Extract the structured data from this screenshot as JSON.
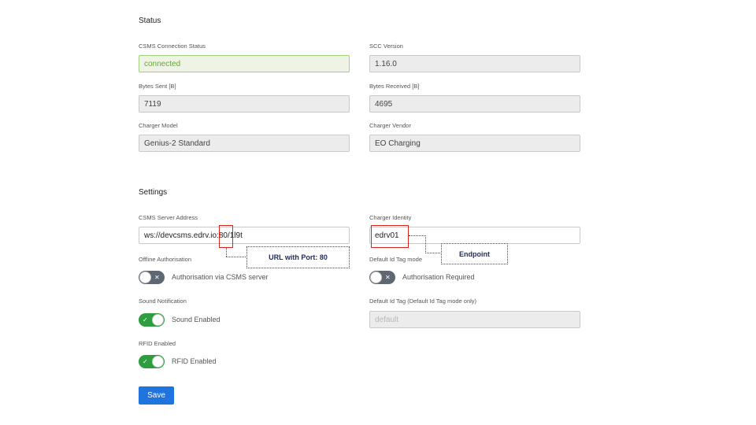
{
  "status": {
    "title": "Status",
    "csms_connection_status": {
      "label": "CSMS Connection Status",
      "value": "connected"
    },
    "scc_version": {
      "label": "SCC Version",
      "value": "1.16.0"
    },
    "bytes_sent": {
      "label": "Bytes Sent [B]",
      "value": "7119"
    },
    "bytes_received": {
      "label": "Bytes Received [B]",
      "value": "4695"
    },
    "charger_model": {
      "label": "Charger Model",
      "value": "Genius-2 Standard"
    },
    "charger_vendor": {
      "label": "Charger Vendor",
      "value": "EO Charging"
    }
  },
  "settings": {
    "title": "Settings",
    "csms_server_address": {
      "label": "CSMS Server Address",
      "value": "ws://devcsms.edrv.io:80/1l9t"
    },
    "charger_identity": {
      "label": "Charger Identity",
      "value": "edrv01"
    },
    "offline_authorisation": {
      "label": "Offline Authorisation",
      "toggle_text": "Authorisation via CSMS server",
      "enabled": false
    },
    "default_id_tag_mode": {
      "label": "Default Id Tag mode",
      "toggle_text": "Authorisation Required",
      "enabled": false
    },
    "sound_notification": {
      "label": "Sound Notification",
      "toggle_text": "Sound Enabled",
      "enabled": true
    },
    "default_id_tag": {
      "label": "Default Id Tag (Default Id Tag mode only)",
      "placeholder": "default"
    },
    "rfid_enabled": {
      "label": "RFID Enabled",
      "toggle_text": "RFID Enabled",
      "enabled": true
    },
    "save_label": "Save"
  },
  "annotations": {
    "url_port": "URL with Port: 80",
    "endpoint": "Endpoint"
  },
  "icons": {
    "toggle_off": "x-icon",
    "toggle_on": "check-icon"
  },
  "colors": {
    "connected_text": "#6aa736",
    "toggle_on": "#2e9d3f",
    "toggle_off": "#5e6772",
    "save_button": "#1f74e0",
    "annotation_box": "#d9231e"
  }
}
